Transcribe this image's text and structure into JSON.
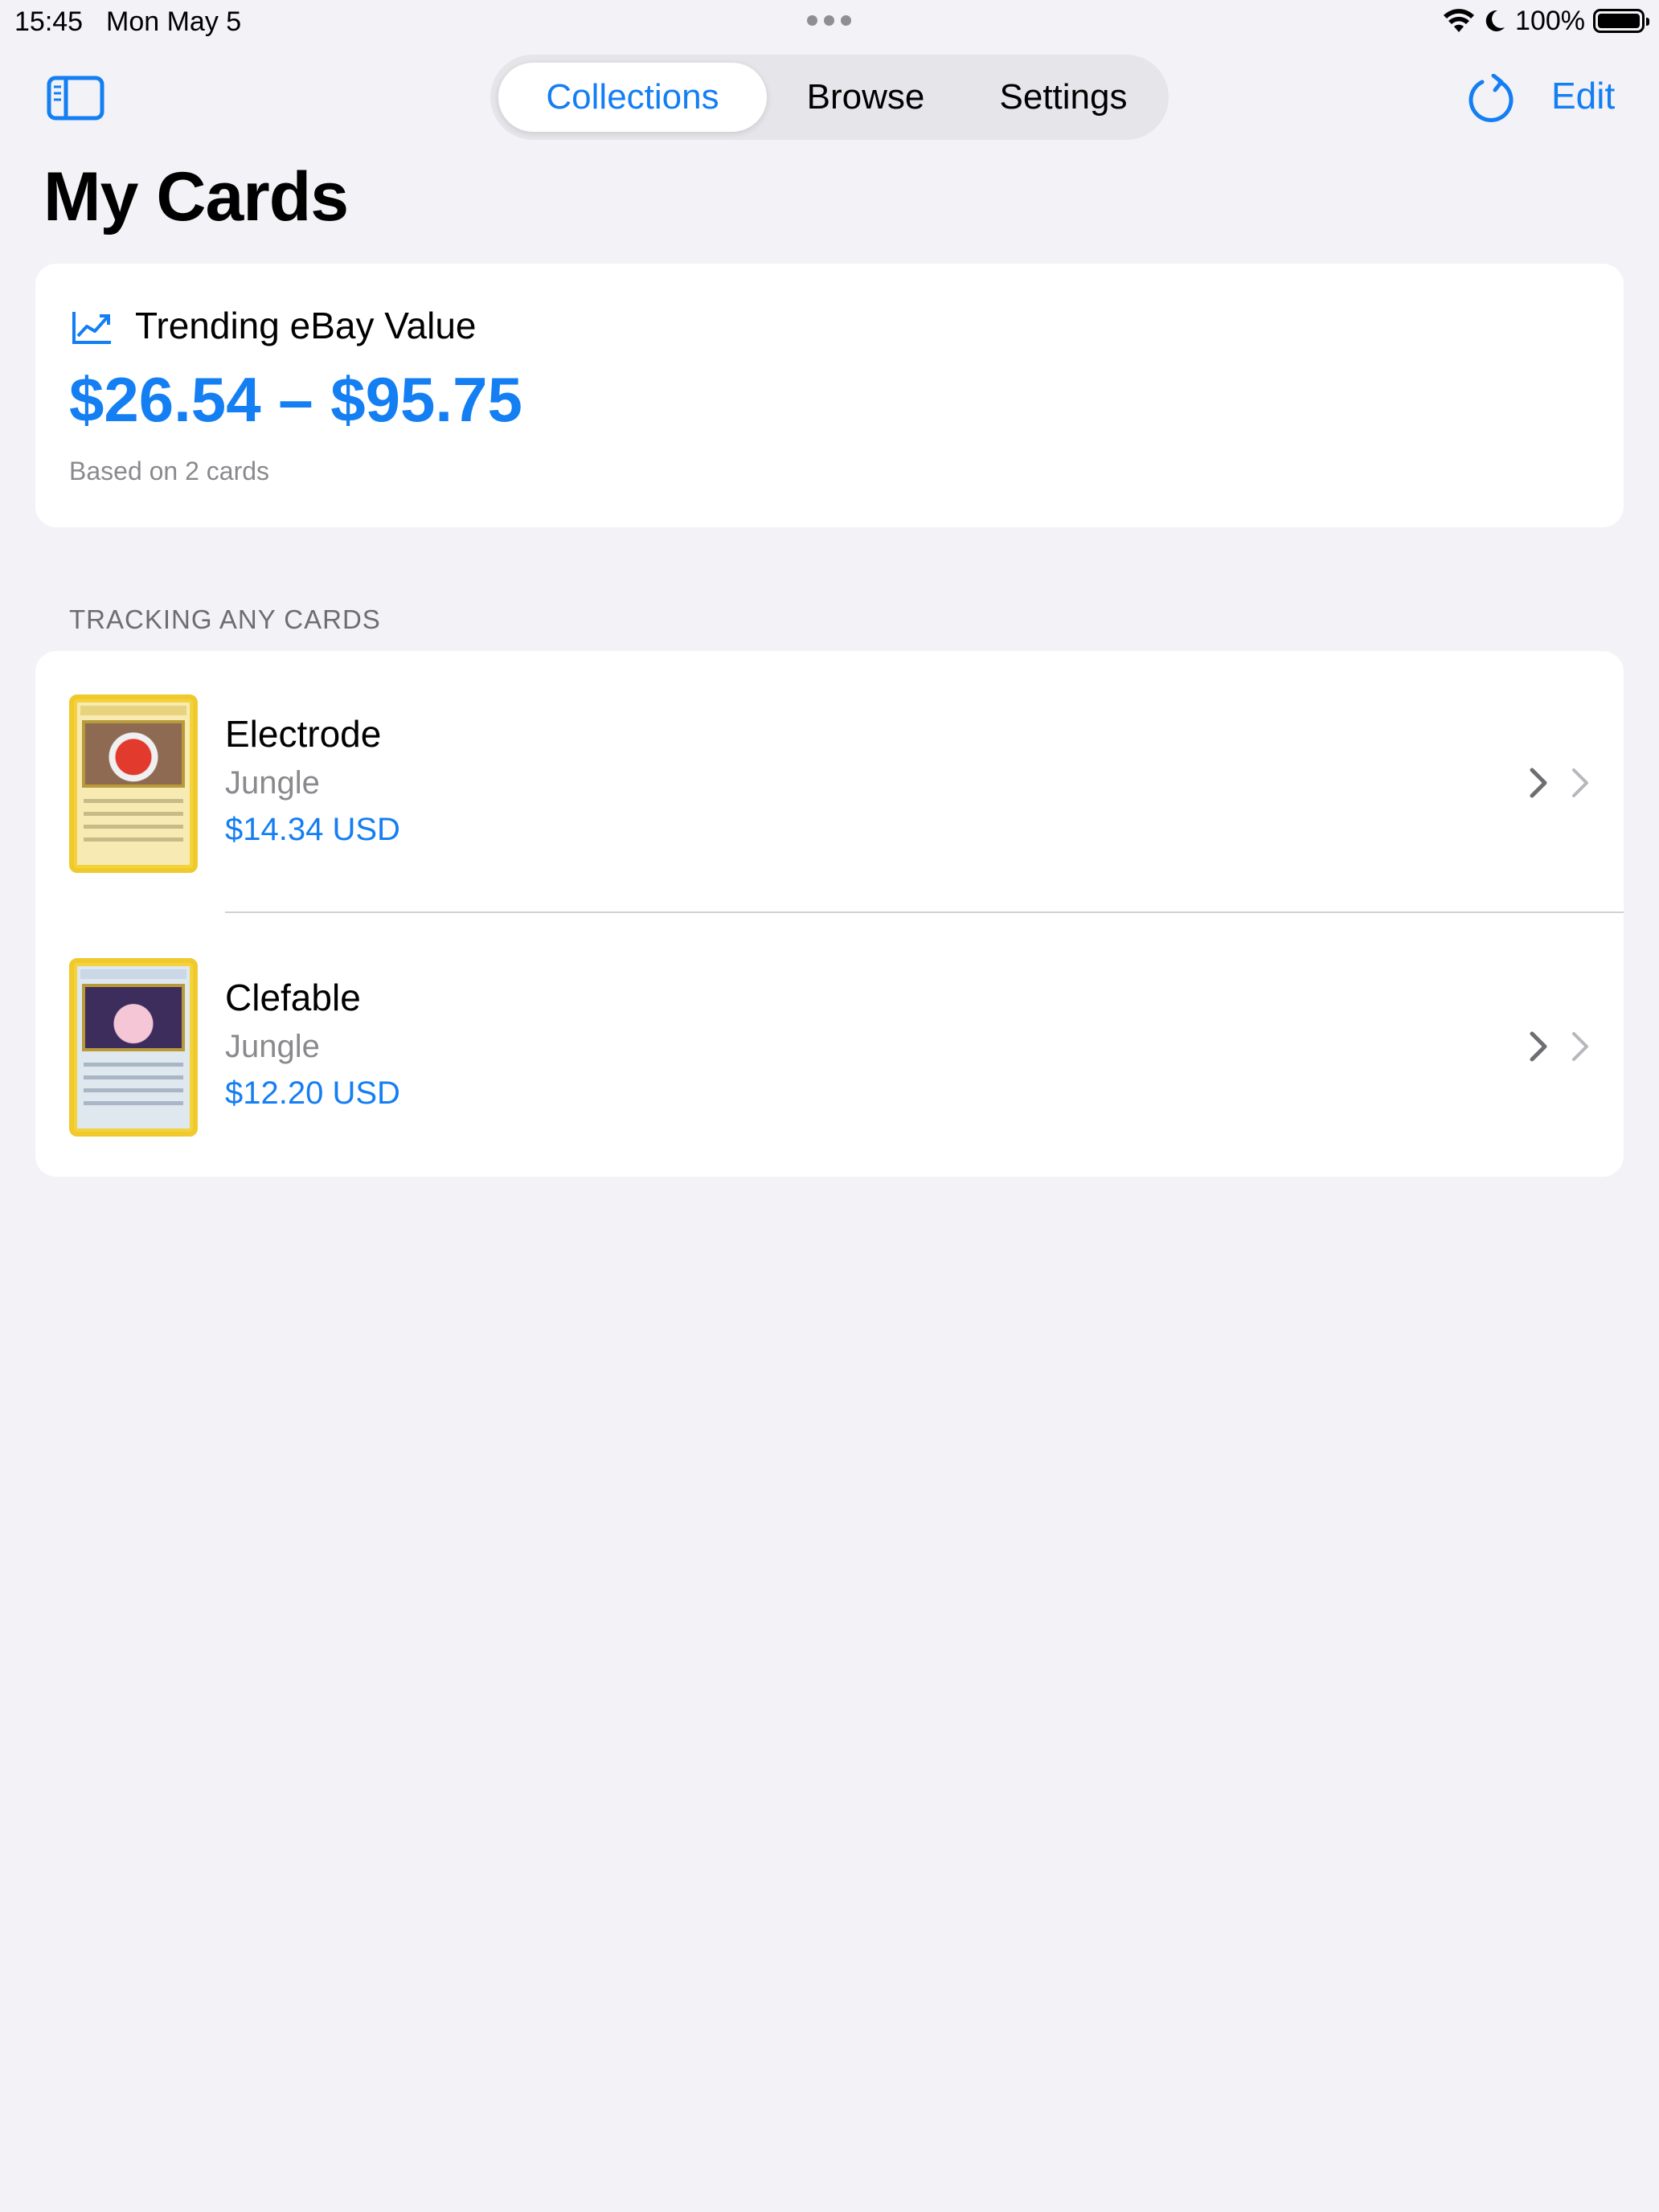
{
  "status_bar": {
    "time": "15:45",
    "date": "Mon May 5",
    "battery": "100%"
  },
  "nav": {
    "tabs": [
      {
        "label": "Collections",
        "active": true
      },
      {
        "label": "Browse",
        "active": false
      },
      {
        "label": "Settings",
        "active": false
      }
    ],
    "edit_label": "Edit",
    "icons": {
      "sidebar": "sidebar-toggle-icon",
      "refresh": "refresh-icon"
    }
  },
  "page": {
    "title": "My Cards"
  },
  "value_card": {
    "label": "Trending eBay Value",
    "range": "$26.54 – $95.75",
    "subtitle": "Based on 2 cards",
    "icon": "trend-chart-icon"
  },
  "section": {
    "header": "TRACKING ANY CARDS"
  },
  "cards": [
    {
      "name": "Electrode",
      "set": "Jungle",
      "price": "$14.34 USD"
    },
    {
      "name": "Clefable",
      "set": "Jungle",
      "price": "$12.20 USD"
    }
  ],
  "colors": {
    "accent": "#147ef3",
    "background": "#f2f2f7",
    "secondary_text": "#8a8a8e"
  }
}
